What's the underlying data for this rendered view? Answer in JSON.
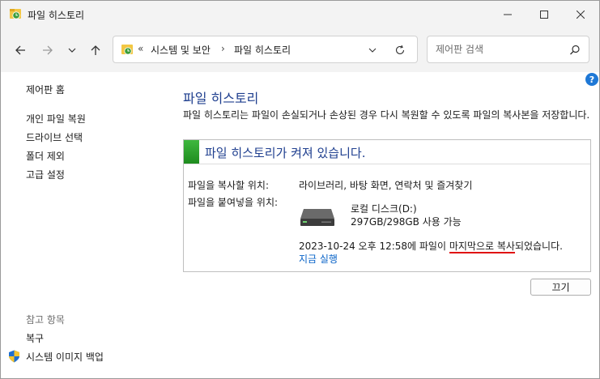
{
  "window": {
    "title": "파일 히스토리"
  },
  "nav": {
    "breadcrumb_prefix": "«",
    "crumbs": [
      "시스템 및 보안",
      "파일 히스토리"
    ],
    "crumb_separator": "›",
    "search_placeholder": "제어판 검색"
  },
  "sidebar": {
    "home": "제어판 홈",
    "links": [
      "개인 파일 복원",
      "드라이브 선택",
      "폴더 제외",
      "고급 설정"
    ],
    "see_also_heading": "참고 항목",
    "see_also": [
      "복구",
      "시스템 이미지 백업"
    ]
  },
  "main": {
    "title": "파일 히스토리",
    "description": "파일 히스토리는 파일이 손실되거나 손상된 경우 다시 복원할 수 있도록 파일의 복사본을 저장합니다.",
    "status": "파일 히스토리가 켜져 있습니다.",
    "copy_from_label": "파일을 복사할 위치:",
    "copy_from_value": "라이브러리, 바탕 화면, 연락처 및 즐겨찾기",
    "copy_to_label": "파일을 붙여넣을 위치:",
    "drive_name": "로컬 디스크(D:)",
    "drive_space": "297GB/298GB 사용 가능",
    "last_copy_prefix": "2023-10-24 오후 12:58에 파일이 ",
    "last_copy_highlight": "마지막으로 복사",
    "last_copy_suffix": "되었습니다.",
    "run_now": "지금 실행",
    "off_button": "끄기"
  },
  "colors": {
    "status_green": "#2aa22a",
    "title_blue": "#1f3f8f",
    "link_blue": "#0a64c8",
    "annotation_red": "#e01010"
  }
}
